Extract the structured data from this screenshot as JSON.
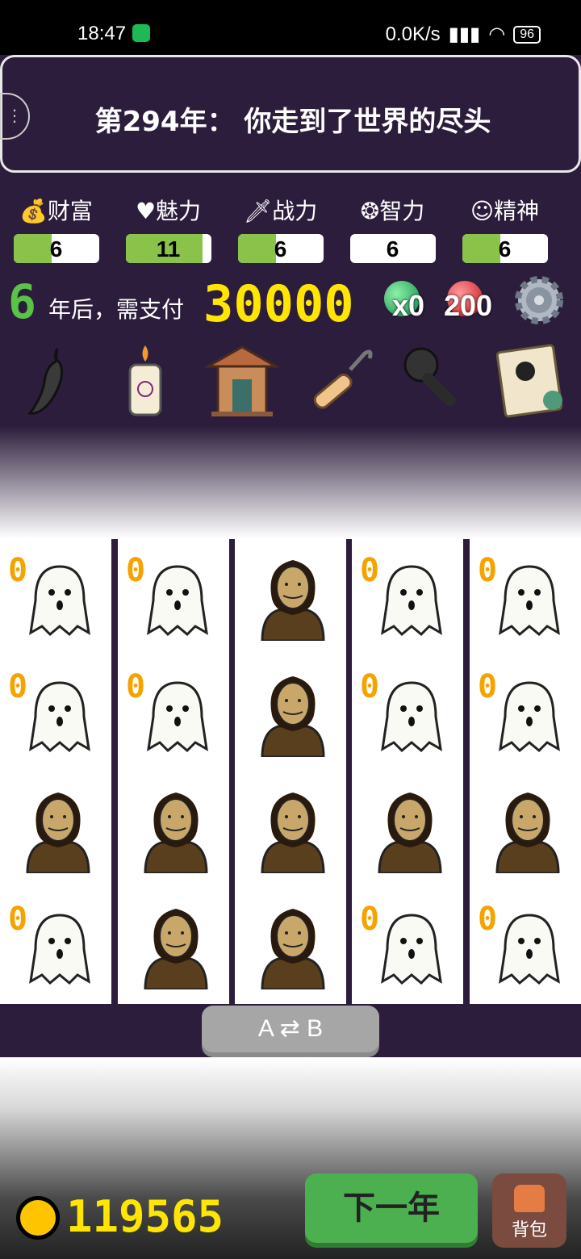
{
  "status_bar": {
    "time": "18:47",
    "network": "0.0K/s",
    "battery": "96"
  },
  "banner": {
    "title": "第294年： 你走到了世界的尽头"
  },
  "stats": [
    {
      "label": "财富",
      "icon": "money-bag-icon",
      "value": "6",
      "fill": 0.45
    },
    {
      "label": "魅力",
      "icon": "heart-icon",
      "value": "11",
      "fill": 0.9
    },
    {
      "label": "战力",
      "icon": "sword-icon",
      "value": "6",
      "fill": 0.45
    },
    {
      "label": "智力",
      "icon": "brain-icon",
      "value": "6",
      "fill": 0.0
    },
    {
      "label": "精神",
      "icon": "mask-icon",
      "value": "6",
      "fill": 0.45
    }
  ],
  "payment": {
    "years": "6",
    "text": "年后，需支付",
    "amount": "30000"
  },
  "gems": {
    "green_count": "x0",
    "red_count": "200"
  },
  "items": [
    "chili-pepper-icon",
    "candle-icon",
    "shrine-icon",
    "hook-icon",
    "microphone-icon",
    "contract-icon"
  ],
  "grid": {
    "columns": [
      [
        "ghost",
        "ghost",
        "man",
        "ghost"
      ],
      [
        "ghost",
        "ghost",
        "man",
        "man"
      ],
      [
        "man",
        "man",
        "man",
        "man"
      ],
      [
        "ghost",
        "ghost",
        "man",
        "ghost"
      ],
      [
        "ghost",
        "ghost",
        "man",
        "ghost"
      ]
    ],
    "ghost_value": "0"
  },
  "swap_button": {
    "a": "A",
    "b": "B"
  },
  "footer": {
    "coins": "119565",
    "next_year": "下一年",
    "backpack": "背包"
  },
  "colors": {
    "bg": "#2c1d3c",
    "accent_green": "#4caf50",
    "gold": "#ffe500",
    "ghost_num": "#f5a300"
  }
}
